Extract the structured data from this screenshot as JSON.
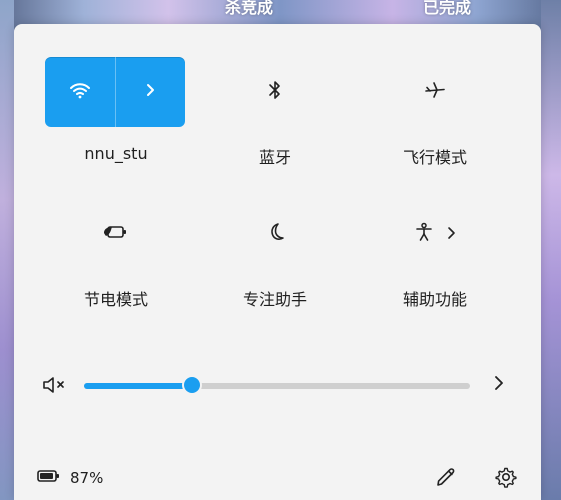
{
  "background": {
    "texts": [
      "杀竞成",
      "已完成"
    ]
  },
  "tiles": {
    "wifi": {
      "label": "nnu_stu",
      "state": "on"
    },
    "bluetooth": {
      "label": "蓝牙"
    },
    "airplane": {
      "label": "飞行模式"
    },
    "battery_saver": {
      "label": "节电模式"
    },
    "focus": {
      "label": "专注助手"
    },
    "accessibility": {
      "label": "辅助功能"
    }
  },
  "volume": {
    "muted": true,
    "level": 0.28
  },
  "footer": {
    "battery_percent": "87%"
  },
  "colors": {
    "accent": "#1a9ef0",
    "panel_bg": "#f3f3f3",
    "text": "#1f1f1f"
  }
}
